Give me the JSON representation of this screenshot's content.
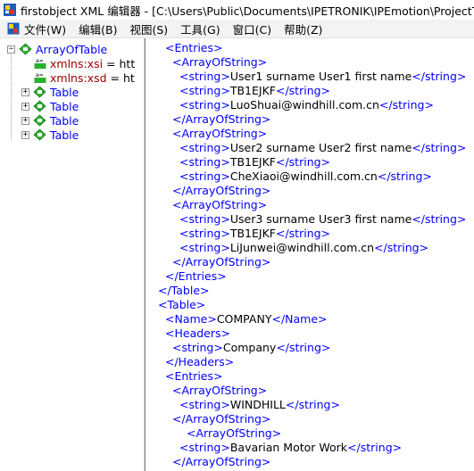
{
  "window": {
    "title": "firstobject XML 编辑器 - [C:\\Users\\Public\\Documents\\IPETRONIK\\IPEmotion\\ProjectTemp"
  },
  "menu": {
    "items": [
      "文件(W)",
      "编辑(B)",
      "视图(S)",
      "工具(G)",
      "窗口(C)",
      "帮助(Z)"
    ]
  },
  "tree": {
    "root": "ArrayOfTable",
    "attributes": [
      {
        "name": "xmlns:xsi",
        "eq": " = ",
        "value": "htt"
      },
      {
        "name": "xmlns:xsd",
        "eq": " = ",
        "value": "ht"
      }
    ],
    "children": [
      "Table",
      "Table",
      "Table",
      "Table"
    ]
  },
  "xml_lines": [
    {
      "indent": 1,
      "tag1": "<Entries>",
      "val": "",
      "tag2": ""
    },
    {
      "indent": 2,
      "tag1": "<ArrayOfString>",
      "val": "",
      "tag2": ""
    },
    {
      "indent": 3,
      "tag1": "<string>",
      "val": "User1 surname User1 first name",
      "tag2": "</string>"
    },
    {
      "indent": 3,
      "tag1": "<string>",
      "val": "TB1EJKF",
      "tag2": "</string>"
    },
    {
      "indent": 3,
      "tag1": "<string>",
      "val": "LuoShuai@windhill.com.cn",
      "tag2": "</string>"
    },
    {
      "indent": 2,
      "tag1": "</ArrayOfString>",
      "val": "",
      "tag2": ""
    },
    {
      "indent": 2,
      "tag1": "<ArrayOfString>",
      "val": "",
      "tag2": ""
    },
    {
      "indent": 3,
      "tag1": "<string>",
      "val": "User2 surname User2 first name",
      "tag2": "</string>"
    },
    {
      "indent": 3,
      "tag1": "<string>",
      "val": "TB1EJKF",
      "tag2": "</string>"
    },
    {
      "indent": 3,
      "tag1": "<string>",
      "val": "CheXiaoi@windhill.com.cn",
      "tag2": "</string>"
    },
    {
      "indent": 2,
      "tag1": "</ArrayOfString>",
      "val": "",
      "tag2": ""
    },
    {
      "indent": 2,
      "tag1": "<ArrayOfString>",
      "val": "",
      "tag2": ""
    },
    {
      "indent": 3,
      "tag1": "<string>",
      "val": "User3 surname User3 first name",
      "tag2": "</string>"
    },
    {
      "indent": 3,
      "tag1": "<string>",
      "val": "TB1EJKF",
      "tag2": "</string>"
    },
    {
      "indent": 3,
      "tag1": "<string>",
      "val": "LiJunwei@windhill.com.cn",
      "tag2": "</string>"
    },
    {
      "indent": 2,
      "tag1": "</ArrayOfString>",
      "val": "",
      "tag2": ""
    },
    {
      "indent": 1,
      "tag1": "</Entries>",
      "val": "",
      "tag2": ""
    },
    {
      "indent": 0,
      "tag1": "</Table>",
      "val": "",
      "tag2": ""
    },
    {
      "indent": 0,
      "tag1": "<Table>",
      "val": "",
      "tag2": ""
    },
    {
      "indent": 1,
      "tag1": "<Name>",
      "val": "COMPANY",
      "tag2": "</Name>"
    },
    {
      "indent": 1,
      "tag1": "<Headers>",
      "val": "",
      "tag2": ""
    },
    {
      "indent": 2,
      "tag1": "<string>",
      "val": "Company",
      "tag2": "</string>"
    },
    {
      "indent": 1,
      "tag1": "</Headers>",
      "val": "",
      "tag2": ""
    },
    {
      "indent": 1,
      "tag1": "<Entries>",
      "val": "",
      "tag2": ""
    },
    {
      "indent": 2,
      "tag1": "<ArrayOfString>",
      "val": "",
      "tag2": ""
    },
    {
      "indent": 3,
      "tag1": "<string>",
      "val": "WINDHILL",
      "tag2": "</string>"
    },
    {
      "indent": 2,
      "tag1": "</ArrayOfString>",
      "val": "",
      "tag2": ""
    },
    {
      "indent": 4,
      "tag1": "<ArrayOfString>",
      "val": "",
      "tag2": ""
    },
    {
      "indent": 3,
      "tag1": "<string>",
      "val": "Bavarian Motor Work",
      "tag2": "</string>"
    },
    {
      "indent": 2,
      "tag1": "</ArrayOfString>",
      "val": "",
      "tag2": ""
    }
  ]
}
